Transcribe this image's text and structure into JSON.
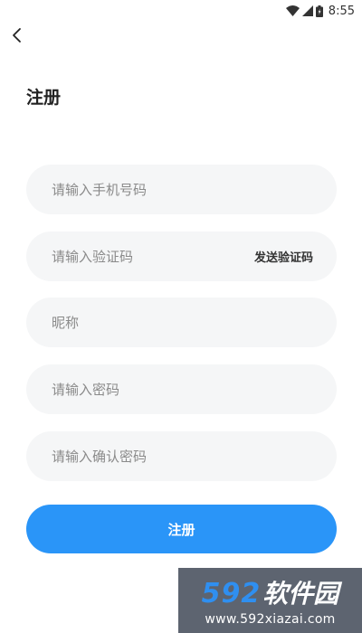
{
  "status_bar": {
    "time": "8:55",
    "icons": [
      "wifi-icon",
      "signal-icon",
      "battery-icon"
    ]
  },
  "header": {
    "back_icon": "chevron-left-icon",
    "title": "注册"
  },
  "form": {
    "phone_placeholder": "请输入手机号码",
    "code_placeholder": "请输入验证码",
    "send_code_label": "发送验证码",
    "nickname_placeholder": "昵称",
    "password_placeholder": "请输入密码",
    "confirm_password_placeholder": "请输入确认密码",
    "submit_label": "注册"
  },
  "watermark": {
    "logo_number": "592",
    "logo_text": "软件园",
    "url": "www.592xiazai.com"
  },
  "colors": {
    "accent": "#2a95f8",
    "field_background": "#f5f6f7",
    "watermark_background": "#5d6470",
    "watermark_number": "#2f8ff0"
  }
}
